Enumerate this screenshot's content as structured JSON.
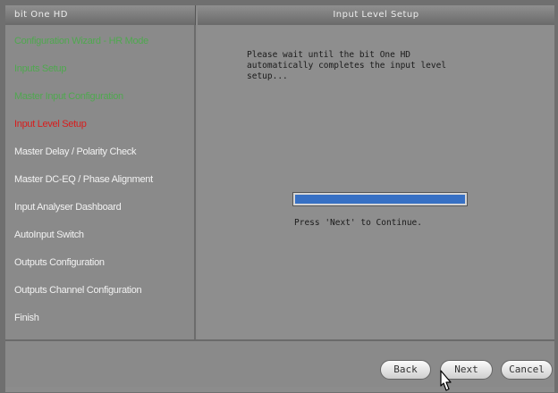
{
  "window": {
    "left_title": "bit One HD",
    "right_title": "Input Level Setup"
  },
  "steps": [
    {
      "label": "Configuration Wizard - HR Mode",
      "status": "done"
    },
    {
      "label": "Inputs Setup",
      "status": "done"
    },
    {
      "label": "Master Input Configuration",
      "status": "done"
    },
    {
      "label": "Input Level Setup",
      "status": "current"
    },
    {
      "label": "Master Delay / Polarity Check",
      "status": "pending"
    },
    {
      "label": "Master DC-EQ / Phase Alignment",
      "status": "pending"
    },
    {
      "label": "Input Analyser Dashboard",
      "status": "pending"
    },
    {
      "label": "AutoInput Switch",
      "status": "pending"
    },
    {
      "label": "Outputs Configuration",
      "status": "pending"
    },
    {
      "label": "Outputs Channel Configuration",
      "status": "pending"
    },
    {
      "label": "Finish",
      "status": "pending"
    }
  ],
  "main": {
    "message": "Please wait until the bit One HD\nautomatically completes the input level\nsetup...",
    "progress_fraction": 1.0,
    "continue_text": "Press 'Next' to Continue."
  },
  "buttons": {
    "back": "Back",
    "next": "Next",
    "cancel": "Cancel"
  },
  "colors": {
    "step_done": "#4fa84f",
    "step_current": "#d81d1d",
    "step_pending": "#f2f2f2",
    "progress_fill": "#3770c4"
  }
}
